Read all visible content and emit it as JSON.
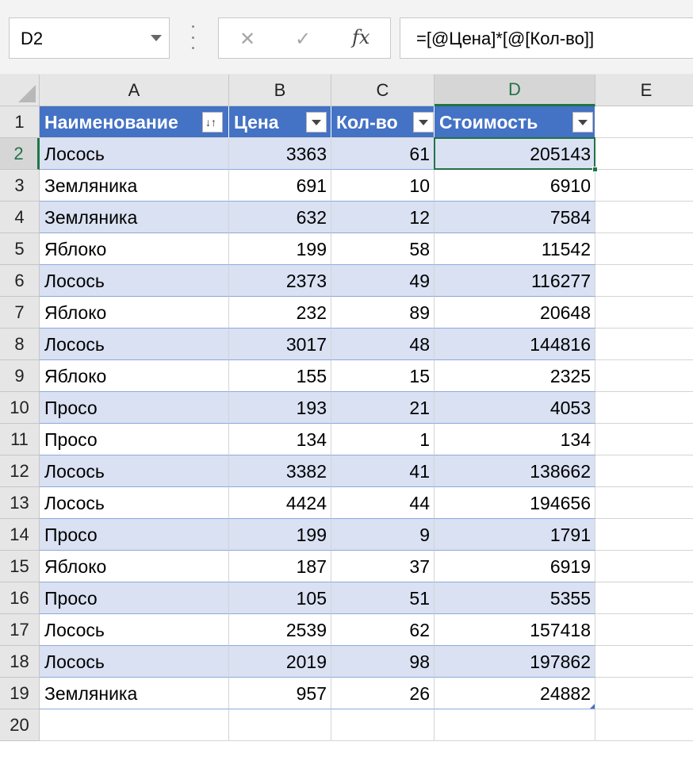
{
  "name_box": "D2",
  "formula_bar": {
    "cancel_icon": "close-icon",
    "enter_icon": "check-icon",
    "fx_label": "fx",
    "formula": "=[@Цена]*[@[Кол-во]]"
  },
  "columns": [
    "A",
    "B",
    "C",
    "D",
    "E"
  ],
  "active_column": "D",
  "active_row": "2",
  "row_numbers": [
    "1",
    "2",
    "3",
    "4",
    "5",
    "6",
    "7",
    "8",
    "9",
    "10",
    "11",
    "12",
    "13",
    "14",
    "15",
    "16",
    "17",
    "18",
    "19",
    "20"
  ],
  "table": {
    "style_colors": {
      "header": "#4472c4",
      "band": "#d9e1f2",
      "accent": "#217346"
    },
    "headers": [
      "Наименование",
      "Цена",
      "Кол-во",
      "Стоимость"
    ],
    "rows": [
      [
        "Лосось",
        "3363",
        "61",
        "205143"
      ],
      [
        "Земляника",
        "691",
        "10",
        "6910"
      ],
      [
        "Земляника",
        "632",
        "12",
        "7584"
      ],
      [
        "Яблоко",
        "199",
        "58",
        "11542"
      ],
      [
        "Лосось",
        "2373",
        "49",
        "116277"
      ],
      [
        "Яблоко",
        "232",
        "89",
        "20648"
      ],
      [
        "Лосось",
        "3017",
        "48",
        "144816"
      ],
      [
        "Яблоко",
        "155",
        "15",
        "2325"
      ],
      [
        "Просо",
        "193",
        "21",
        "4053"
      ],
      [
        "Просо",
        "134",
        "1",
        "134"
      ],
      [
        "Лосось",
        "3382",
        "41",
        "138662"
      ],
      [
        "Лосось",
        "4424",
        "44",
        "194656"
      ],
      [
        "Просо",
        "199",
        "9",
        "1791"
      ],
      [
        "Яблоко",
        "187",
        "37",
        "6919"
      ],
      [
        "Просо",
        "105",
        "51",
        "5355"
      ],
      [
        "Лосось",
        "2539",
        "62",
        "157418"
      ],
      [
        "Лосось",
        "2019",
        "98",
        "197862"
      ],
      [
        "Земляника",
        "957",
        "26",
        "24882"
      ]
    ]
  }
}
